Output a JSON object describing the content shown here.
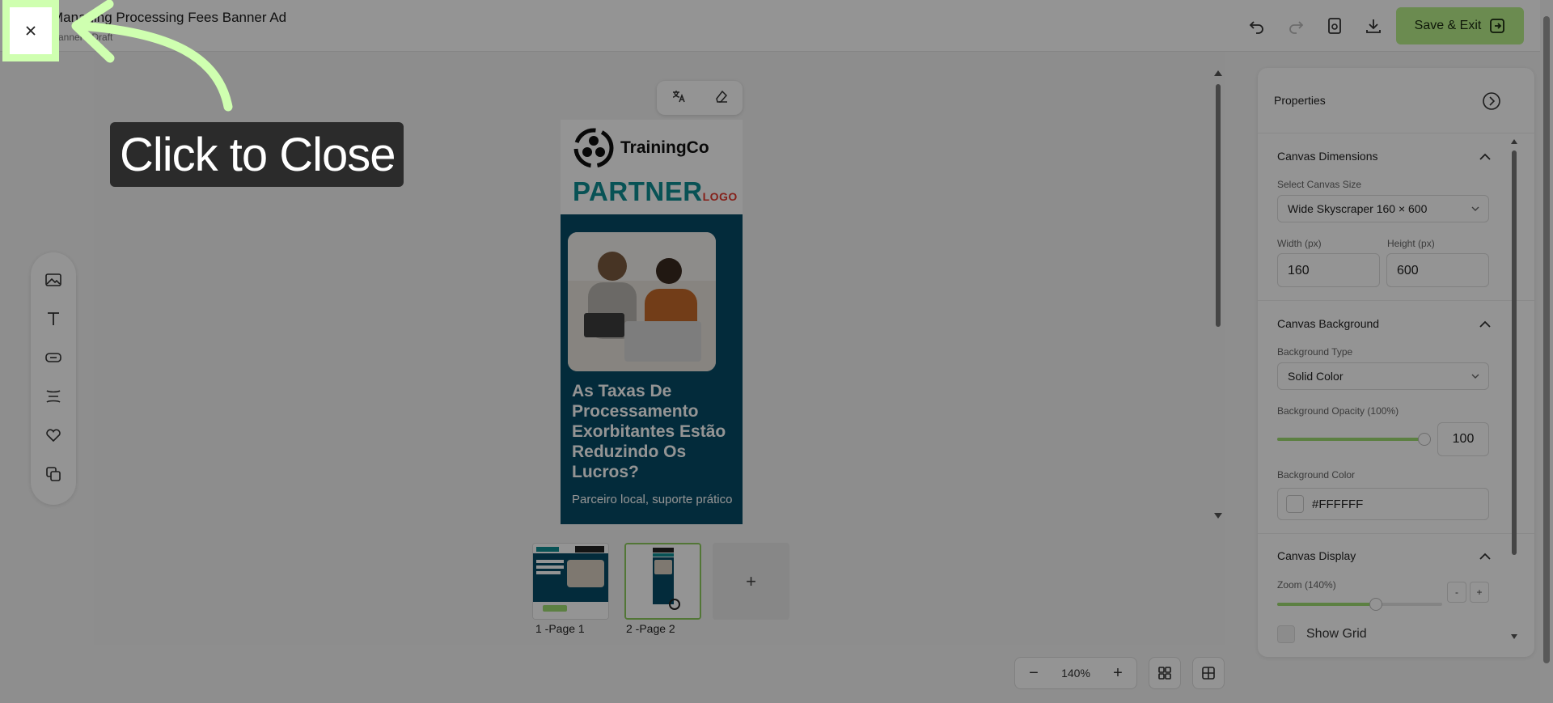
{
  "header": {
    "title": "Managing Processing Fees Banner Ad",
    "subtitle": "Banner · Draft",
    "save_label": "Save & Exit"
  },
  "colors": {
    "accent": "#b8f08a",
    "banner_teal": "#0f8d93",
    "banner_navy": "#064b66",
    "partner_red": "#e53a2e"
  },
  "banner": {
    "brand": "TrainingCo",
    "partner": "PARTNER",
    "partner_suffix": "LOGO",
    "headline": "As Taxas De Processamento Exorbitantes Estão Reduzindo Os Lucros?",
    "subline": "Parceiro local, suporte prático"
  },
  "left_toolbar": [
    "image-icon",
    "text-icon",
    "button-icon",
    "spacer-icon",
    "heart-icon",
    "layers-icon"
  ],
  "pages": [
    {
      "label": "1 -Page 1",
      "active": false
    },
    {
      "label": "2 -Page 2",
      "active": true
    }
  ],
  "add_page_label": "+",
  "zoom": {
    "value": "140%",
    "minus": "−",
    "plus": "+"
  },
  "properties": {
    "title": "Properties",
    "canvas_dimensions": {
      "title": "Canvas Dimensions",
      "size_label": "Select Canvas Size",
      "size_value": "Wide Skyscraper 160 × 600",
      "width_label": "Width (px)",
      "width_value": "160",
      "height_label": "Height (px)",
      "height_value": "600"
    },
    "canvas_background": {
      "title": "Canvas Background",
      "type_label": "Background Type",
      "type_value": "Solid Color",
      "opacity_label": "Background Opacity (100%)",
      "opacity_value": "100",
      "opacity_fraction": 1.0,
      "color_label": "Background Color",
      "color_value": "#FFFFFF"
    },
    "canvas_display": {
      "title": "Canvas Display",
      "zoom_label": "Zoom (140%)",
      "zoom_fraction": 0.6,
      "minus": "-",
      "plus": "+",
      "show_grid_label": "Show Grid"
    }
  },
  "overlay": {
    "callout": "Click to Close"
  }
}
